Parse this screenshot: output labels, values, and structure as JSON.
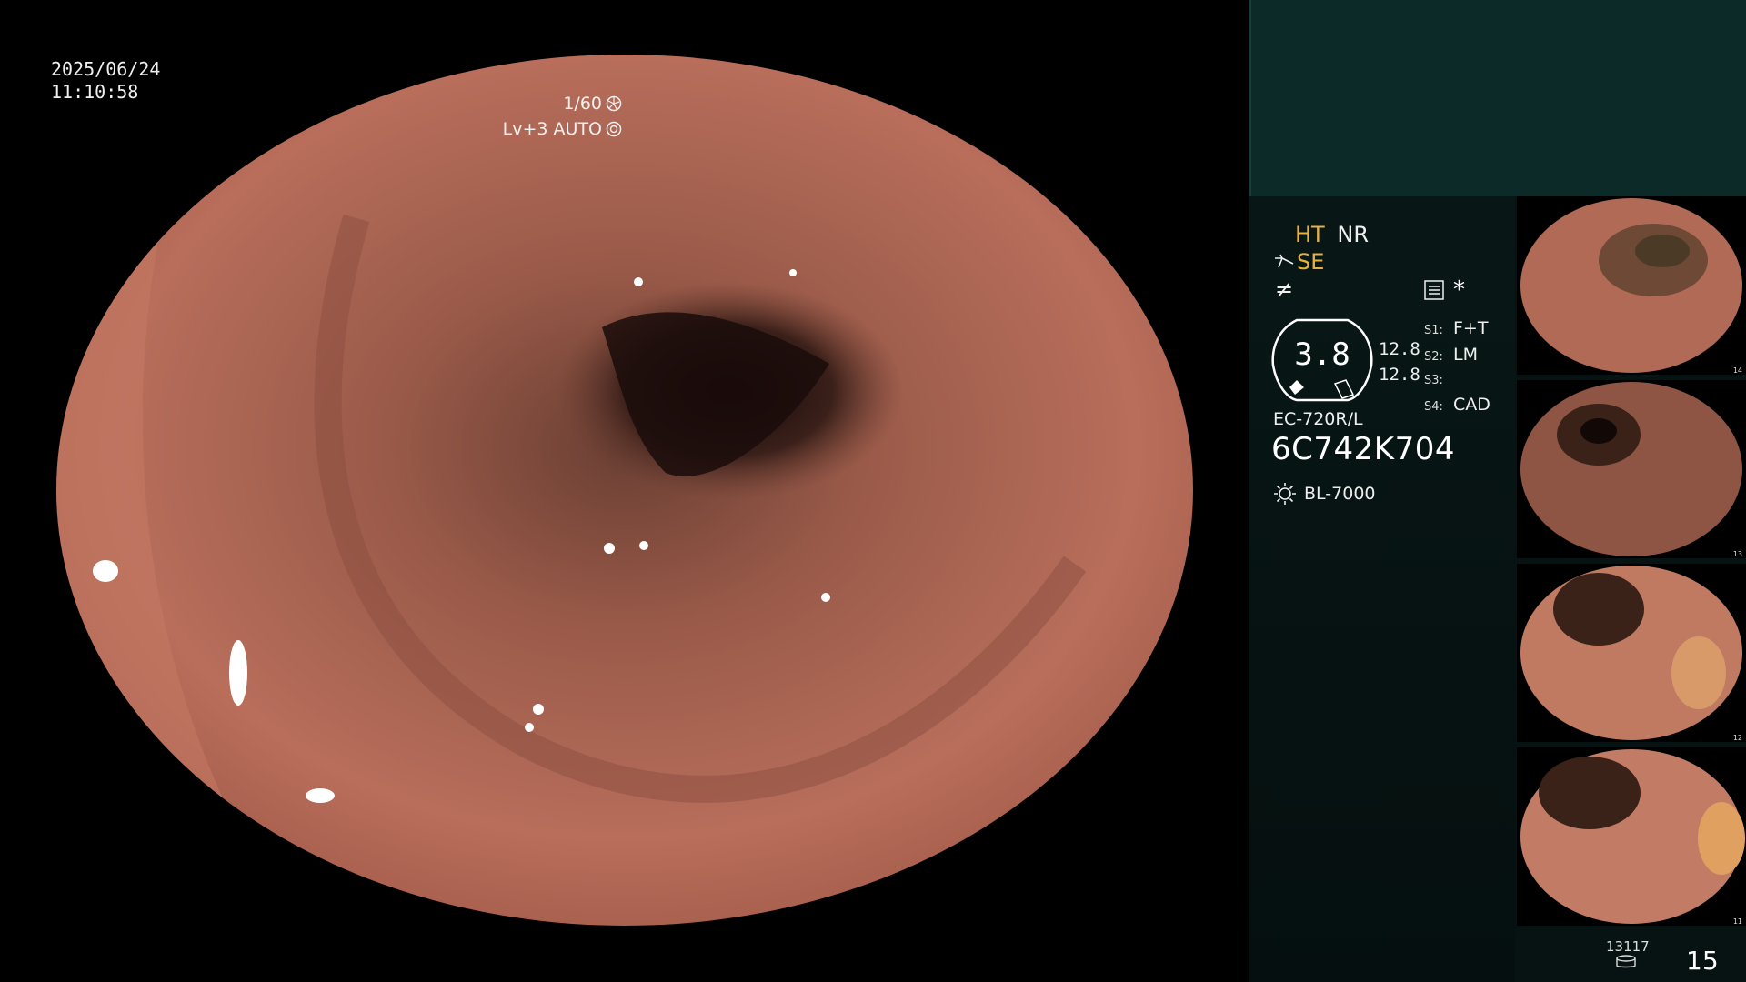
{
  "overlay": {
    "date": "2025/06/24",
    "time": "11:10:58",
    "shutter": "1/60",
    "level": "Lv+3 AUTO"
  },
  "panel": {
    "ht": "HT",
    "nr": "NR",
    "se": "SE",
    "gauge_value": "3.8",
    "gauge_top": "12.8",
    "gauge_bottom": "12.8",
    "slots": [
      {
        "key": "S1:",
        "value": "F+T"
      },
      {
        "key": "S2:",
        "value": "LM"
      },
      {
        "key": "S3:",
        "value": ""
      },
      {
        "key": "S4:",
        "value": "CAD"
      }
    ],
    "scope_model": "EC-720R/L",
    "scope_serial": "6C742K704",
    "light_source": "BL-7000"
  },
  "thumbnails": [
    {
      "label": "14"
    },
    {
      "label": "13"
    },
    {
      "label": "12"
    },
    {
      "label": "11"
    }
  ],
  "footer": {
    "storage_count": "13117",
    "page_number": "15"
  },
  "colors": {
    "accent_yellow": "#e8b040",
    "panel_bg": "#061312",
    "top_box": "#0b2a28",
    "mucosa": "#b9705c"
  },
  "icons": [
    "shutter-icon",
    "auto-iris-icon",
    "scope-angle-icon",
    "freeze-icon",
    "menu-icon",
    "asterisk-icon",
    "light-source-icon",
    "storage-icon"
  ]
}
